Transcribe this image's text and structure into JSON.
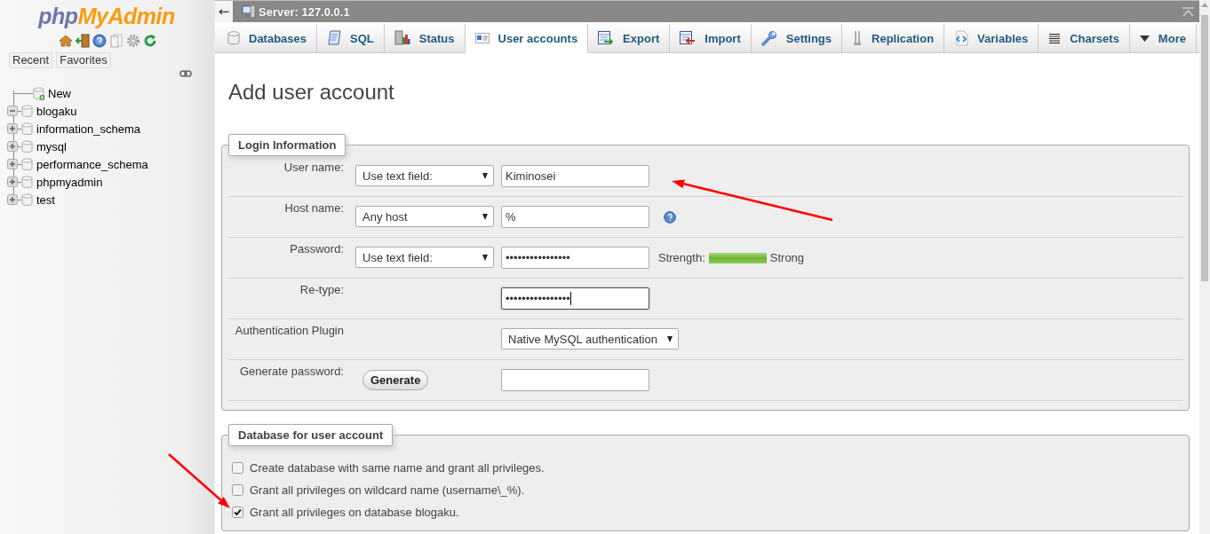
{
  "sidebar": {
    "logo": {
      "part_1": "php",
      "part_2": "MyAdmin"
    },
    "buttons": [
      {
        "label": "Recent"
      },
      {
        "label": "Favorites"
      }
    ],
    "tree": [
      {
        "label": "New",
        "kind": "new"
      },
      {
        "label": "blogaku",
        "kind": "database",
        "expanded": true
      },
      {
        "label": "information_schema",
        "kind": "database",
        "expanded": false
      },
      {
        "label": "mysql",
        "kind": "database",
        "expanded": false
      },
      {
        "label": "performance_schema",
        "kind": "database",
        "expanded": false
      },
      {
        "label": "phpmyadmin",
        "kind": "database",
        "expanded": false
      },
      {
        "label": "test",
        "kind": "database",
        "expanded": false
      }
    ]
  },
  "topbar": {
    "back": "←",
    "breadcrumb": "Server: 127.0.0.1"
  },
  "tabs": [
    {
      "label": "Databases",
      "selected": false
    },
    {
      "label": "SQL",
      "selected": false
    },
    {
      "label": "Status",
      "selected": false
    },
    {
      "label": "User accounts",
      "selected": true
    },
    {
      "label": "Export",
      "selected": false
    },
    {
      "label": "Import",
      "selected": false
    },
    {
      "label": "Settings",
      "selected": false
    },
    {
      "label": "Replication",
      "selected": false
    },
    {
      "label": "Variables",
      "selected": false
    },
    {
      "label": "Charsets",
      "selected": false
    },
    {
      "label": "More",
      "selected": false
    }
  ],
  "page_title": "Add user account",
  "login": {
    "legend": "Login Information",
    "rows": [
      {
        "kind": "select-field",
        "label": "User name:",
        "select": "Use text field:",
        "value": "Kiminosei",
        "focused": false
      },
      {
        "kind": "select-field",
        "label": "Host name:",
        "select": "Any host",
        "value": "%",
        "focused": false,
        "help": true
      },
      {
        "kind": "select-field",
        "label": "Password:",
        "select": "Use text field:",
        "value": "••••••••••••••••",
        "focused": false,
        "strength": {
          "label": "Strength:",
          "level": 1,
          "reading": "Strong"
        }
      },
      {
        "kind": "field",
        "label": "Re-type:",
        "value": "••••••••••••••••",
        "focused": true
      },
      {
        "kind": "plugin",
        "label": "Authentication Plugin",
        "select": "Native MySQL authentication"
      },
      {
        "kind": "generate",
        "label": "Generate password:",
        "button": "Generate",
        "focused": false
      }
    ]
  },
  "database": {
    "legend": "Database for user account",
    "options": [
      {
        "label": "Create database with same name and grant all privileges.",
        "checked": false
      },
      {
        "label": "Grant all privileges on wildcard name (username\\_%).",
        "checked": false
      },
      {
        "label": "Grant all privileges on database blogaku.",
        "checked": true
      }
    ]
  },
  "annotations": [
    {
      "kind": "arrow"
    },
    {
      "kind": "arrow"
    }
  ]
}
